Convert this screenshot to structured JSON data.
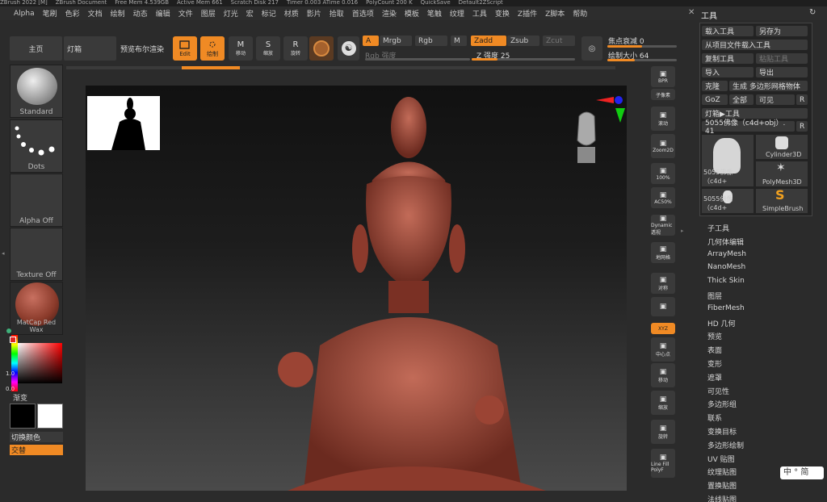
{
  "titlebar": {
    "items": [
      "ZBrush 2022 [M]",
      "ZBrush Document",
      "Free Mem 4.539GB",
      "Active Mem 661",
      "Scratch Disk 217",
      "Timer 0.003 ATime 0.016",
      "PolyCount 200 K",
      "QuickSave",
      "Default2ZScript"
    ]
  },
  "menu": [
    "Alpha",
    "笔刷",
    "色彩",
    "文档",
    "绘制",
    "动态",
    "编辑",
    "文件",
    "图层",
    "灯光",
    "宏",
    "标记",
    "材质",
    "影片",
    "拾取",
    "首选项",
    "渲染",
    "模板",
    "笔触",
    "纹理",
    "工具",
    "变换",
    "Z插件",
    "Z脚本",
    "帮助"
  ],
  "shelf": {
    "home": "主页",
    "lightbox": "灯箱",
    "preview_render": "预览布尔渲染",
    "edit": "Edit",
    "draw": "绘制",
    "move": "移动",
    "scale": "缩放",
    "rotate": "旋转",
    "a_label": "A",
    "mrgb": "Mrgb",
    "rgb": "Rgb",
    "m": "M",
    "rgb_intensity": "Rgb 强度",
    "zadd": "Zadd",
    "zsub": "Zsub",
    "zcut": "Zcut",
    "z_intensity": "Z 强度 25",
    "focal_shift": "焦点衰减 0",
    "draw_size": "绘制大小 64"
  },
  "left": {
    "brush": "Standard",
    "stroke": "Dots",
    "alpha": "Alpha Off",
    "texture": "Texture Off",
    "material": "MatCap Red Wax",
    "gradient": "渐变",
    "switch_color": "切换颜色",
    "alternate": "交替",
    "gradient_values": [
      "1.0",
      "0.0"
    ]
  },
  "righttools": [
    {
      "name": "bpr",
      "label": "BPR"
    },
    {
      "name": "subpixel",
      "label": "子像素"
    },
    {
      "name": "scroll",
      "label": "滚动"
    },
    {
      "name": "zoom2d",
      "label": "Zoom2D"
    },
    {
      "name": "zoom100",
      "label": "100%"
    },
    {
      "name": "ac50",
      "label": "AC50%"
    },
    {
      "name": "dynamic-perspective",
      "label": "Dynamic 透视"
    },
    {
      "name": "floor",
      "label": "地网格"
    },
    {
      "name": "symmetry",
      "label": "对称"
    },
    {
      "name": "lock",
      "label": ""
    },
    {
      "name": "xyz",
      "label": "XYZ"
    },
    {
      "name": "frame",
      "label": "中心点"
    },
    {
      "name": "move",
      "label": "移动"
    },
    {
      "name": "zoom3d",
      "label": "缩放"
    },
    {
      "name": "rotate",
      "label": "旋转"
    },
    {
      "name": "linefill",
      "label": "Line Fill PolyF"
    }
  ],
  "tool_panel": {
    "title": "工具",
    "load_tool": "载入工具",
    "save_as": "另存为",
    "load_from_project": "从项目文件载入工具",
    "copy_tool": "复制工具",
    "paste_tool": "粘贴工具",
    "import": "导入",
    "export": "导出",
    "clone": "克隆",
    "make_polymesh": "生成 多边形网格物体",
    "goz": "GoZ",
    "all": "全部",
    "visible": "可见",
    "r": "R",
    "lightbox_tools": "灯箱▶工具",
    "current_tool": "5055佛像（c4d+obj）. 41",
    "thumbs": [
      {
        "name": "5055佛像（c4d+"
      },
      {
        "name": "Cylinder3D"
      },
      {
        "name": "PolyMesh3D"
      },
      {
        "name": "5055佛像（c4d+"
      },
      {
        "name": "SimpleBrush"
      }
    ]
  },
  "tool_sections": [
    "子工具",
    "几何体编辑",
    "ArrayMesh",
    "NanoMesh",
    "Thick Skin",
    "图层",
    "FiberMesh",
    "HD 几何",
    "预览",
    "表面",
    "变形",
    "遮罩",
    "可见性",
    "多边形组",
    "联系",
    "变换目标",
    "多边形绘制",
    "UV 贴图",
    "纹理贴图",
    "置换贴图",
    "法线贴图"
  ],
  "ime": "中 ° 简"
}
